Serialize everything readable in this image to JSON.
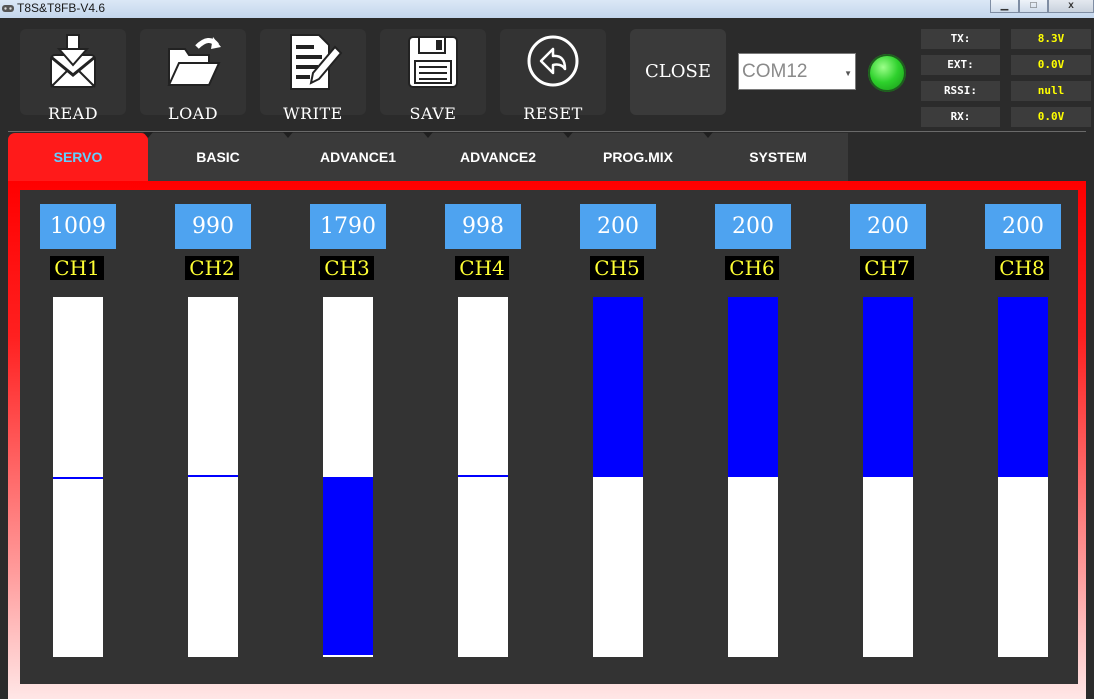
{
  "window": {
    "title": "T8S&T8FB-V4.6",
    "controls": [
      "▁",
      "□",
      "x"
    ]
  },
  "toolbar": {
    "read": {
      "label": "READ",
      "icon": "envelope-download-icon"
    },
    "load": {
      "label": "LOAD",
      "icon": "folder-open-icon"
    },
    "write": {
      "label": "WRITE",
      "icon": "document-edit-icon"
    },
    "save": {
      "label": "SAVE",
      "icon": "floppy-disk-icon"
    },
    "reset": {
      "label": "RESET",
      "icon": "reset-arrow-icon"
    },
    "close": {
      "label": "CLOSE"
    },
    "port": {
      "value": "COM12"
    },
    "connection_led_color": "#2ed12c"
  },
  "status": {
    "tx": {
      "label": "TX:",
      "value": "8.3V"
    },
    "ext": {
      "label": "EXT:",
      "value": "0.0V"
    },
    "rssi": {
      "label": "RSSI:",
      "value": "null"
    },
    "rx": {
      "label": "RX:",
      "value": "0.0V"
    }
  },
  "tabs": [
    {
      "label": "SERVO",
      "active": true
    },
    {
      "label": "BASIC",
      "active": false
    },
    {
      "label": "ADVANCE1",
      "active": false
    },
    {
      "label": "ADVANCE2",
      "active": false
    },
    {
      "label": "PROG.MIX",
      "active": false
    },
    {
      "label": "SYSTEM",
      "active": false
    }
  ],
  "channels": [
    {
      "name": "CH1",
      "value": "1009"
    },
    {
      "name": "CH2",
      "value": "990"
    },
    {
      "name": "CH3",
      "value": "1790"
    },
    {
      "name": "CH4",
      "value": "998"
    },
    {
      "name": "CH5",
      "value": "200"
    },
    {
      "name": "CH6",
      "value": "200"
    },
    {
      "name": "CH7",
      "value": "200"
    },
    {
      "name": "CH8",
      "value": "200"
    }
  ],
  "colors": {
    "accent": "#ff0000",
    "bar_fill": "#0000ff",
    "value_box": "#4ea3f0",
    "label_text": "#ffff33"
  }
}
